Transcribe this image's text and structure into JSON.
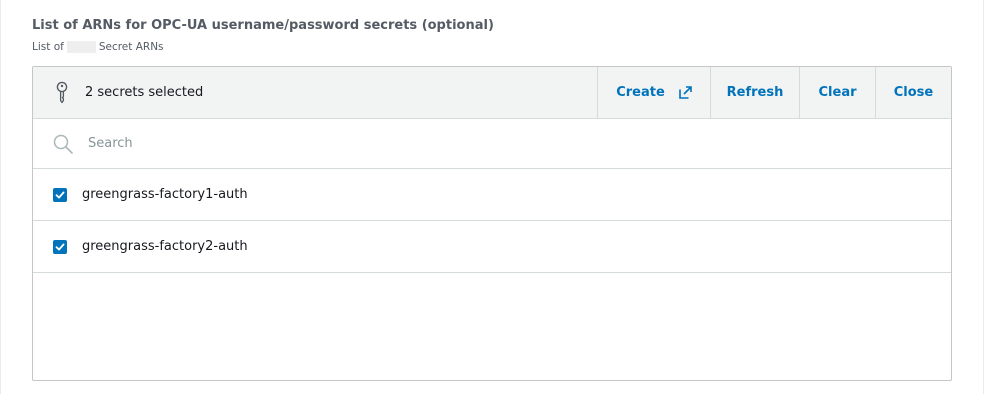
{
  "field": {
    "label": "List of ARNs for OPC-UA username/password secrets (optional)",
    "description_prefix": "List of",
    "description_suffix": "Secret ARNs"
  },
  "toolbar": {
    "status_icon": "key-icon",
    "status_text": "2 secrets selected",
    "create_label": "Create",
    "create_icon": "external-link-icon",
    "refresh_label": "Refresh",
    "clear_label": "Clear",
    "close_label": "Close"
  },
  "search": {
    "icon": "search-icon",
    "placeholder": "Search",
    "value": ""
  },
  "secrets": [
    {
      "label": "greengrass-factory1-auth",
      "checked": true
    },
    {
      "label": "greengrass-factory2-auth",
      "checked": true
    }
  ],
  "colors": {
    "accent": "#0073bb",
    "text": "#16191f",
    "muted_text": "#545b64",
    "toolbar_bg": "#f2f3f3",
    "border": "#d5dbdb"
  }
}
